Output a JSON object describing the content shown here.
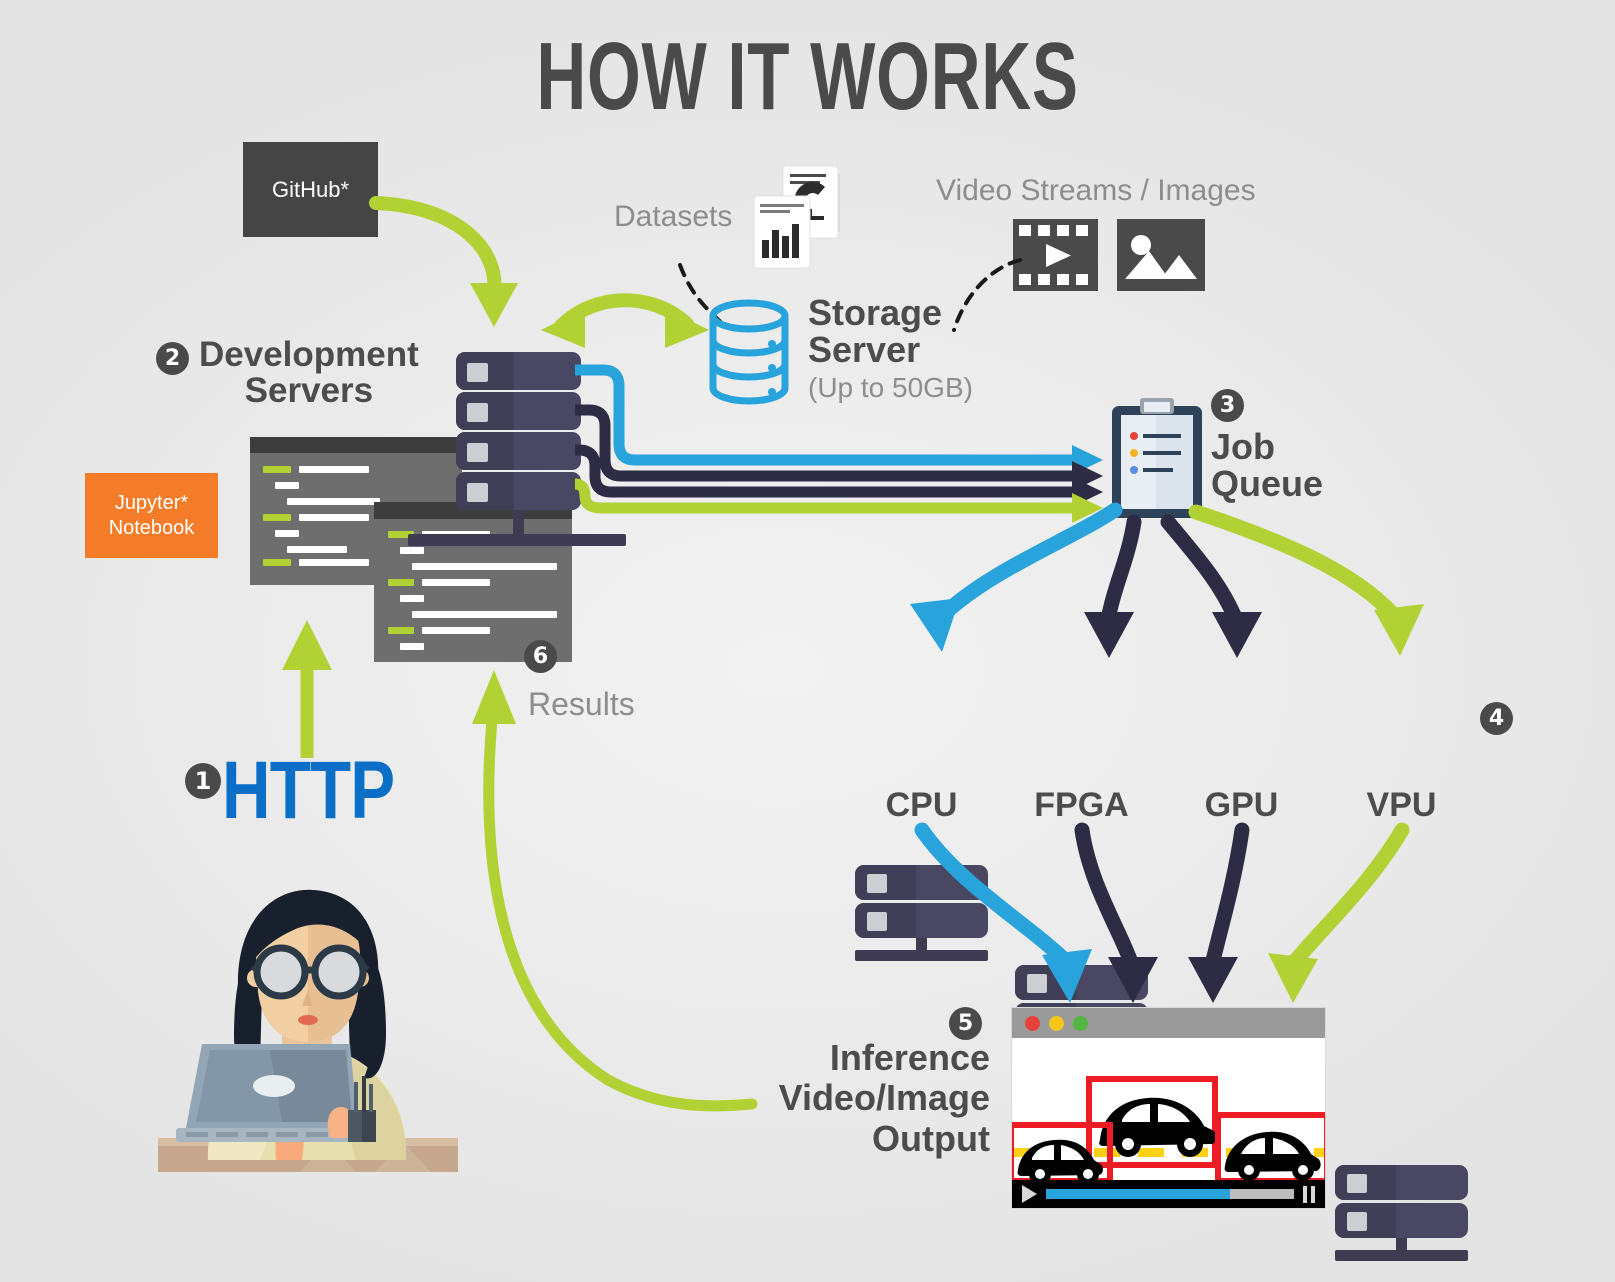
{
  "title": "HOW IT WORKS",
  "colors": {
    "background": "#ececec",
    "green": "#b2d135",
    "blue": "#29a3dc",
    "dark_navy": "#2e2b44",
    "http_blue": "#0b6fc7",
    "orange": "#f47c28",
    "dark_grey": "#454545",
    "rack": "#4a4763",
    "red_box": "#ee1c25",
    "yellow_lane": "#fcd116",
    "text_grey": "#4c4c4c",
    "label_grey": "#8d8d8d"
  },
  "sources": {
    "github": {
      "label": "GitHub*"
    },
    "jupyter": {
      "line1": "Jupyter*",
      "line2": "Notebook"
    },
    "datasets": {
      "label": "Datasets",
      "icon": "document-chart-icon"
    },
    "video_streams": {
      "label": "Video Streams / Images",
      "icons": [
        "film-strip-icon",
        "picture-icon"
      ]
    }
  },
  "steps": [
    {
      "number": "1",
      "label": "HTTP"
    },
    {
      "number": "2",
      "label_line1": "Development",
      "label_line2": "Servers"
    },
    {
      "number": "3",
      "label_line1": "Job",
      "label_line2": "Queue"
    },
    {
      "number": "4",
      "label": ""
    },
    {
      "number": "5",
      "label_line1": "Inference",
      "label_line2": "Video/Image",
      "label_line3": "Output"
    },
    {
      "number": "6",
      "label": "Results"
    }
  ],
  "storage": {
    "title_line1": "Storage",
    "title_line2": "Server",
    "capacity": "(Up to 50GB)",
    "icon": "database-cylinder-icon"
  },
  "job_queue": {
    "title_line1": "Job",
    "title_line2": "Queue",
    "icon": "clipboard-icon",
    "bullet_colors": [
      "#e8413a",
      "#f5b220",
      "#5a8fe0"
    ]
  },
  "compute_nodes": [
    {
      "name": "CPU",
      "arrow_color": "#29a3dc"
    },
    {
      "name": "FPGA",
      "arrow_color": "#2e2b44"
    },
    {
      "name": "GPU",
      "arrow_color": "#2e2b44"
    },
    {
      "name": "VPU",
      "arrow_color": "#b2d135"
    }
  ],
  "inference_output": {
    "title_line1": "Inference",
    "title_line2": "Video/Image",
    "title_line3": "Output",
    "window_dots": [
      "#e8413a",
      "#f5c518",
      "#52b544"
    ],
    "detections": 3,
    "progress_percent": 74,
    "play_icon": "play-icon",
    "pause_icon": "pause-icon"
  },
  "user": {
    "icon": "person-at-laptop-illustration"
  },
  "pipes": {
    "dev_to_queue_colors": [
      "#29a3dc",
      "#2e2b44",
      "#2e2b44",
      "#b2d135"
    ]
  }
}
